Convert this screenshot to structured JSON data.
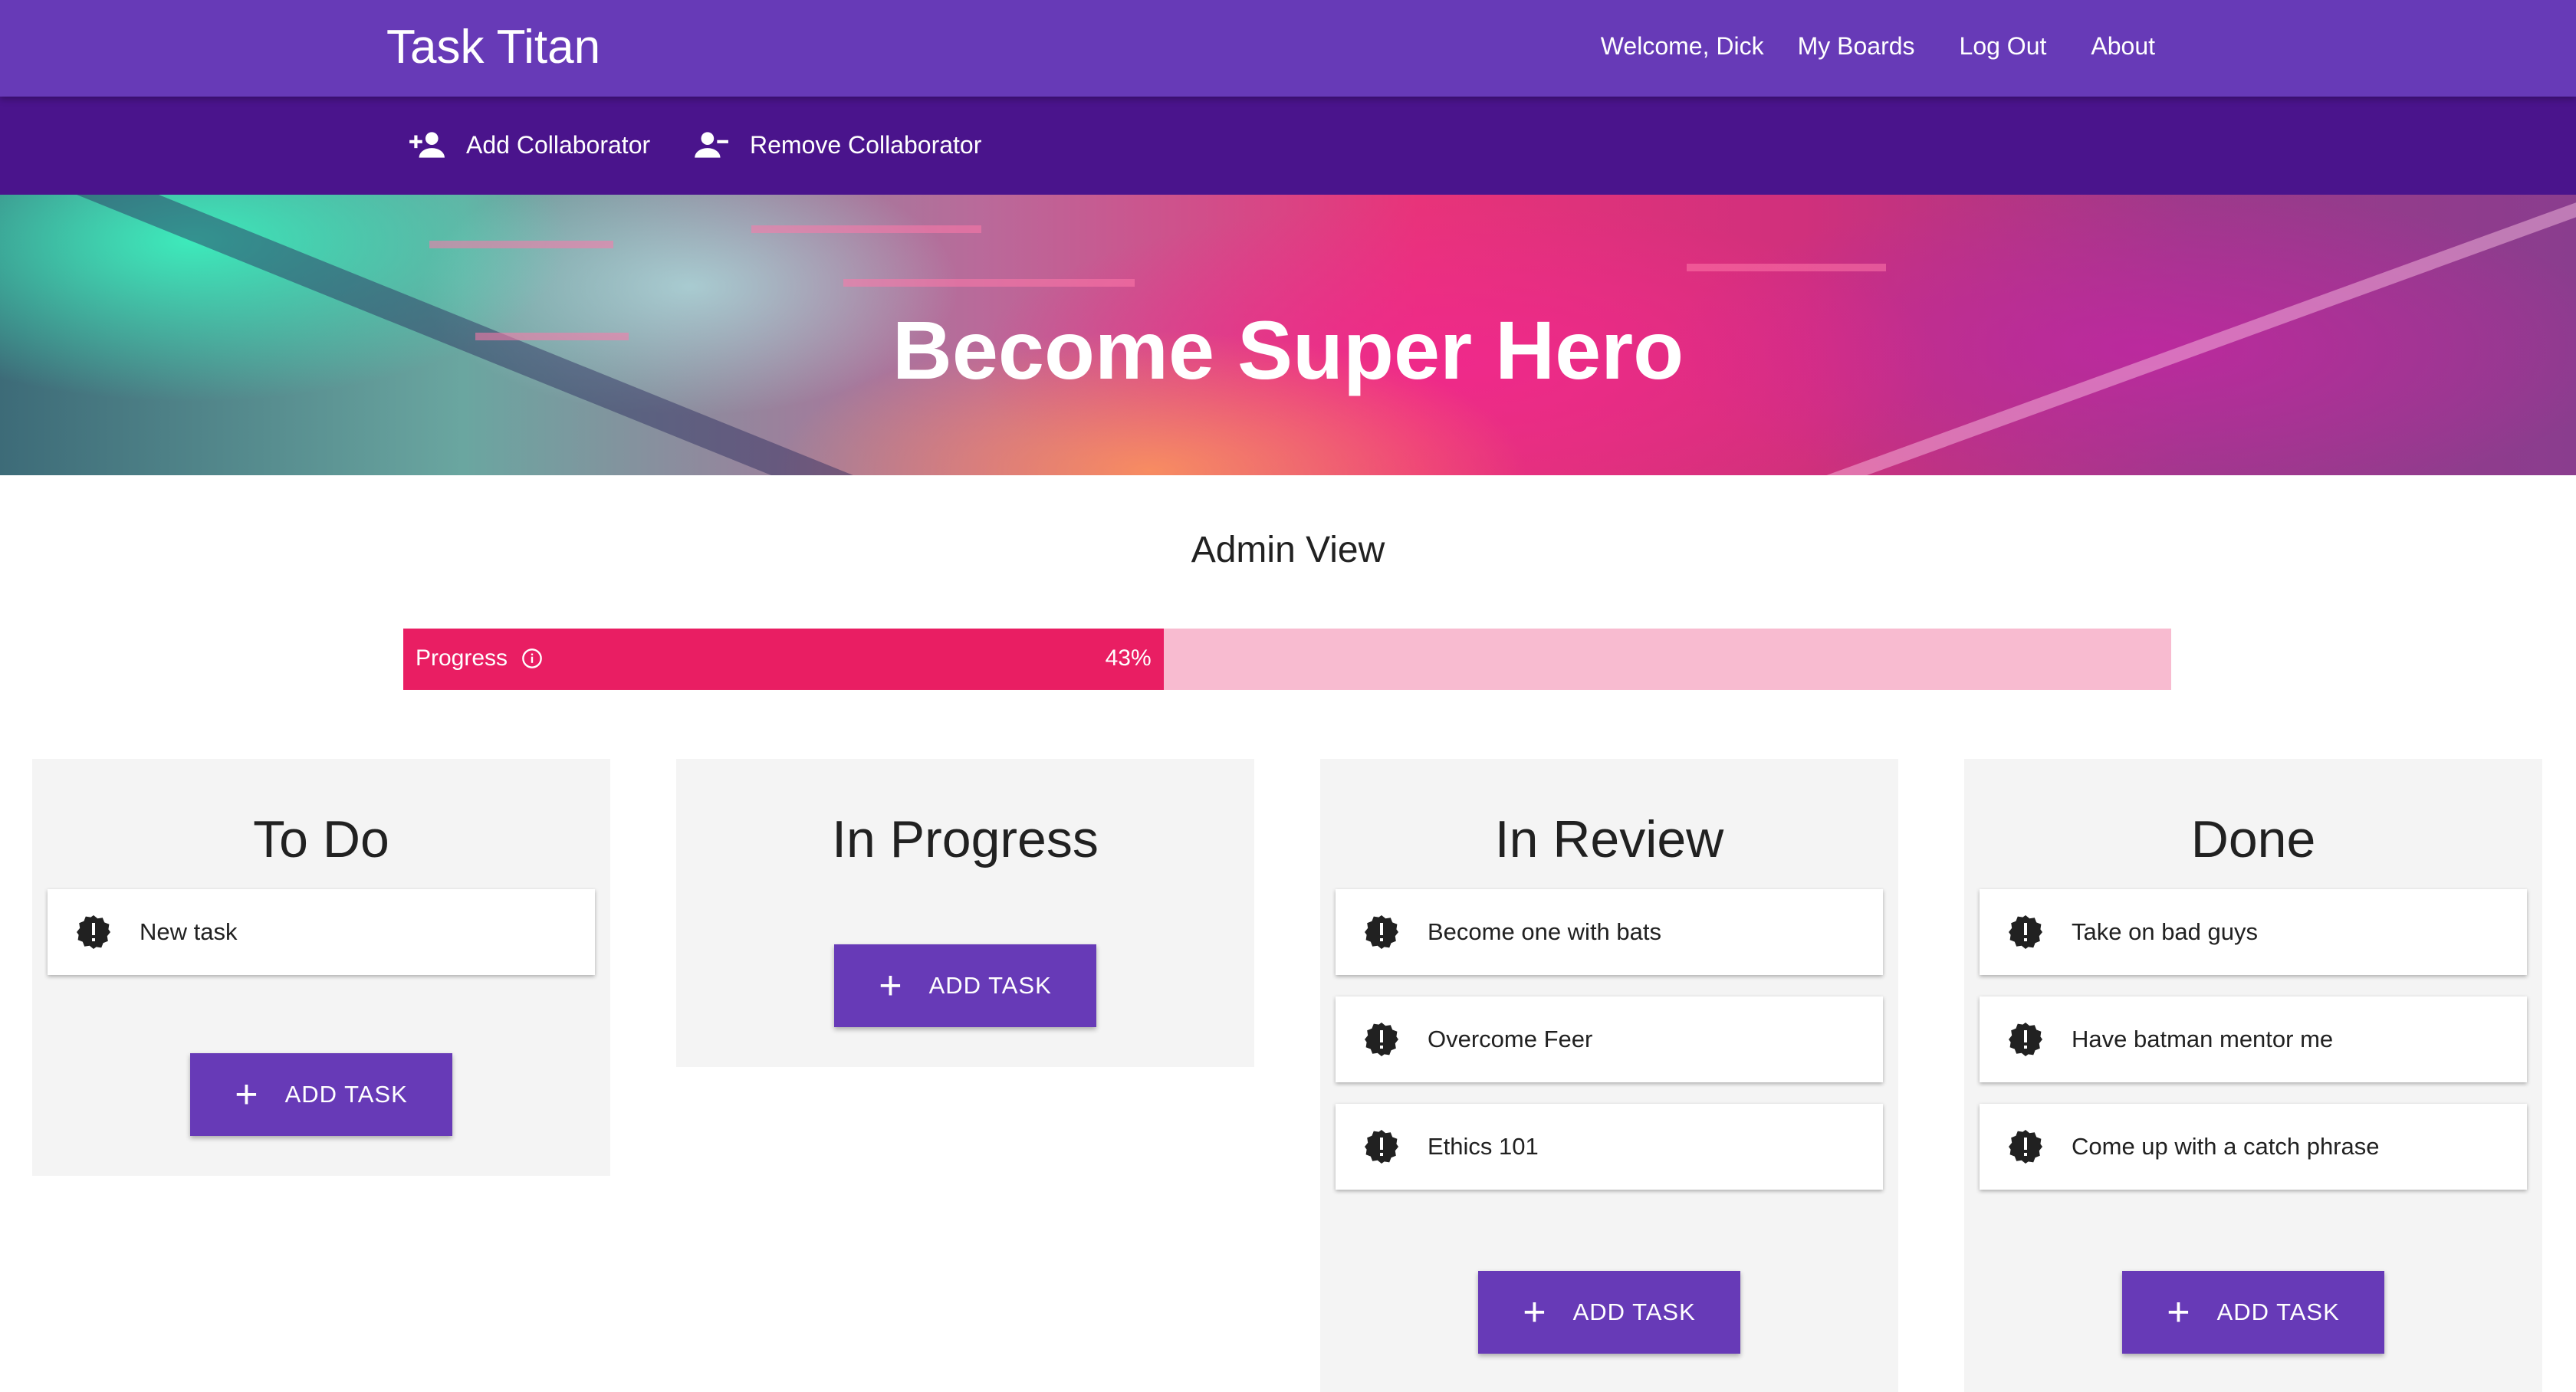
{
  "app": {
    "title": "Task Titan",
    "nav": {
      "welcome": "Welcome, Dick",
      "my_boards": "My Boards",
      "log_out": "Log Out",
      "about": "About"
    }
  },
  "toolbar": {
    "add_collaborator": "Add Collaborator",
    "remove_collaborator": "Remove Collaborator"
  },
  "board": {
    "title": "Become Super Hero",
    "view_label": "Admin View"
  },
  "progress": {
    "label": "Progress",
    "percent_text": "43%",
    "value": 0.43,
    "fill_color": "#e91e63",
    "track_color": "#f8bbd0"
  },
  "colors": {
    "primary": "#673ab7",
    "primary_dark": "#4a148c",
    "column_bg": "#f4f4f4"
  },
  "columns": [
    {
      "title": "To Do",
      "tasks": [
        "New task"
      ],
      "add_label": "ADD TASK"
    },
    {
      "title": "In Progress",
      "tasks": [],
      "add_label": "ADD TASK"
    },
    {
      "title": "In Review",
      "tasks": [
        "Become one with bats",
        "Overcome Feer",
        "Ethics 101"
      ],
      "add_label": "ADD TASK"
    },
    {
      "title": "Done",
      "tasks": [
        "Take on bad guys",
        "Have batman mentor me",
        "Come up with a catch phrase"
      ],
      "add_label": "ADD TASK"
    }
  ],
  "icons": {
    "task": "new-releases-icon",
    "add": "plus-icon",
    "add_collaborator": "person-add-icon",
    "remove_collaborator": "person-remove-icon",
    "progress_info": "info-icon"
  }
}
